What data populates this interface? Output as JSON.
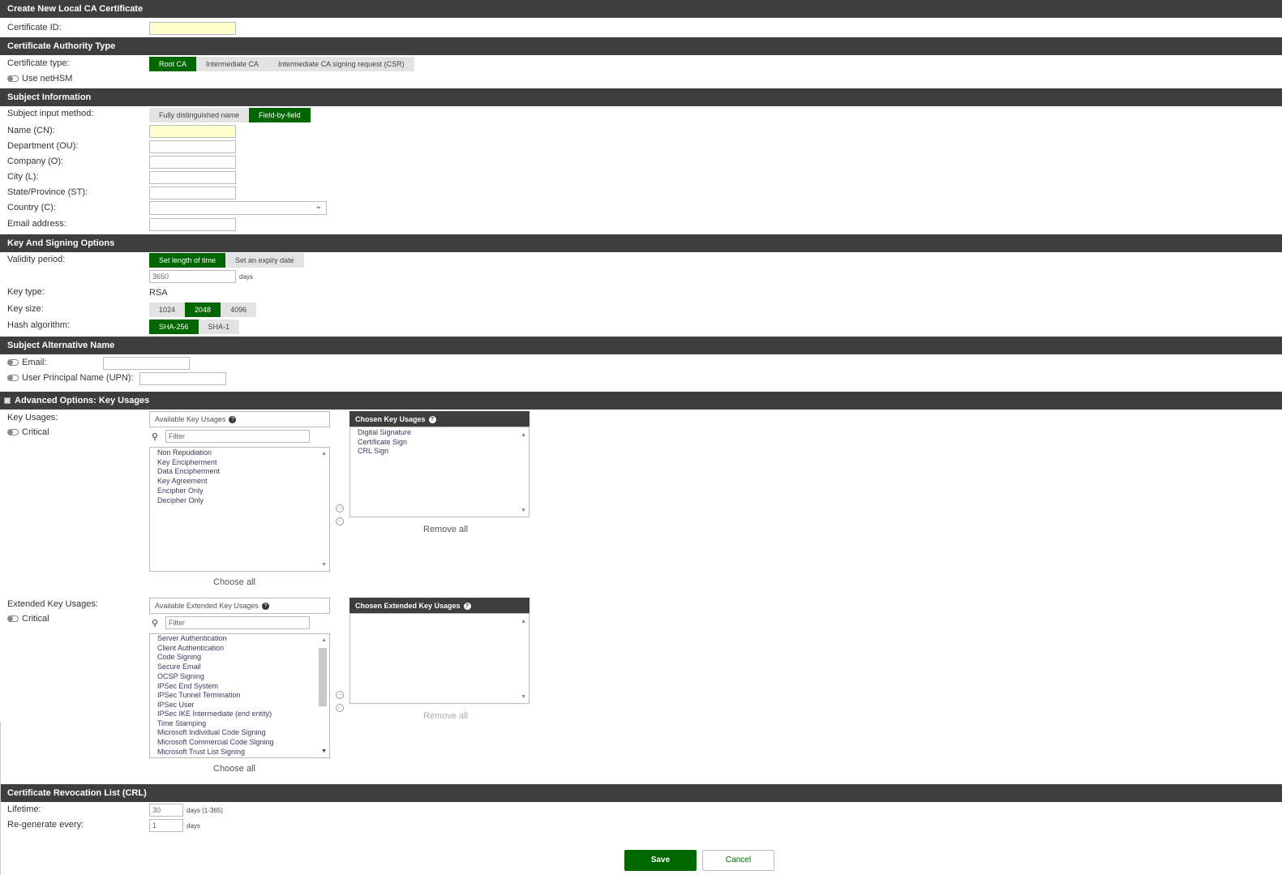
{
  "header": {
    "title": "Create New Local CA Certificate"
  },
  "certificate_id": {
    "label": "Certificate ID:",
    "value": ""
  },
  "ca_type": {
    "section_title": "Certificate Authority Type",
    "type_label": "Certificate type:",
    "options": [
      "Root CA",
      "Intermediate CA",
      "Intermediate CA signing request (CSR)"
    ],
    "selected": "Root CA",
    "nethsm_label": "Use netHSM"
  },
  "subject": {
    "section_title": "Subject Information",
    "method_label": "Subject input method:",
    "methods": [
      "Fully distinguished name",
      "Field-by-field"
    ],
    "selected_method": "Field-by-field",
    "fields": {
      "cn": "Name (CN):",
      "ou": "Department (OU):",
      "o": "Company (O):",
      "l": "City (L):",
      "st": "State/Province (ST):",
      "c": "Country (C):",
      "email": "Email address:"
    }
  },
  "key_signing": {
    "section_title": "Key And Signing Options",
    "validity_label": "Validity period:",
    "validity_options": [
      "Set length of time",
      "Set an expiry date"
    ],
    "validity_selected": "Set length of time",
    "validity_value": "3650",
    "validity_unit": "days",
    "key_type_label": "Key type:",
    "key_type_value": "RSA",
    "key_size_label": "Key size:",
    "key_sizes": [
      "1024",
      "2048",
      "4096"
    ],
    "key_size_selected": "2048",
    "hash_label": "Hash algorithm:",
    "hash_options": [
      "SHA-256",
      "SHA-1"
    ],
    "hash_selected": "SHA-256"
  },
  "san": {
    "section_title": "Subject Alternative Name",
    "email_label": "Email:",
    "upn_label": "User Principal Name (UPN):"
  },
  "advanced": {
    "section_title": "Advanced Options: Key Usages",
    "key_usages_label": "Key Usages:",
    "critical_label": "Critical",
    "available_title": "Available Key Usages",
    "chosen_title": "Chosen Key Usages",
    "filter_placeholder": "Filter",
    "available_items": [
      "Non Repudiation",
      "Key Encipherment",
      "Data Encipherment",
      "Key Agreement",
      "Encipher Only",
      "Decipher Only"
    ],
    "chosen_items": [
      "Digital Signature",
      "Certificate Sign",
      "CRL Sign"
    ],
    "choose_all": "Choose all",
    "remove_all": "Remove all",
    "ext_label": "Extended Key Usages:",
    "ext_available_title": "Available Extended Key Usages",
    "ext_chosen_title": "Chosen Extended Key Usages",
    "ext_available_items": [
      "Server Authentication",
      "Client Authentication",
      "Code Signing",
      "Secure Email",
      "OCSP Signing",
      "IPSec End System",
      "IPSec Tunnel Termination",
      "IPSec User",
      "IPSec IKE Intermediate (end entity)",
      "Time Stamping",
      "Microsoft Individual Code Signing",
      "Microsoft Commercial Code Signing",
      "Microsoft Trust List Signing"
    ]
  },
  "crl": {
    "section_title": "Certificate Revocation List (CRL)",
    "lifetime_label": "Lifetime:",
    "lifetime_value": "30",
    "lifetime_unit": "days (1-365)",
    "regen_label": "Re-generate every:",
    "regen_value": "1",
    "regen_unit": "days"
  },
  "actions": {
    "save": "Save",
    "cancel": "Cancel"
  },
  "colors": {
    "header_bg": "#3e3e3e",
    "accent_green": "#006600",
    "required_bg": "#ffffcc"
  }
}
